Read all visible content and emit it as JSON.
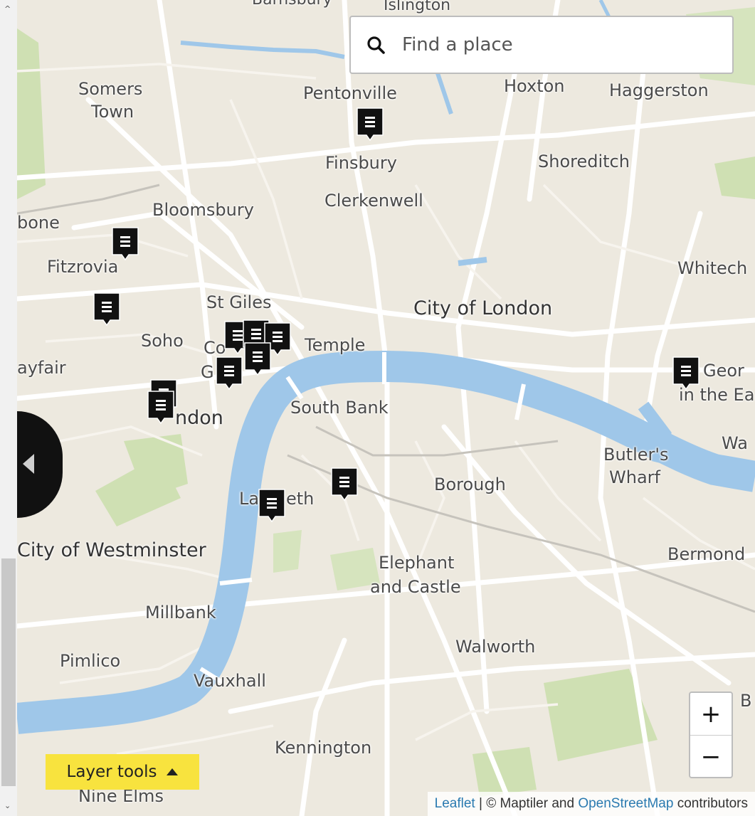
{
  "search": {
    "placeholder": "Find a place",
    "icon": "search-icon"
  },
  "places": {
    "barnsbury": "Barnsbury",
    "islington": "Islington",
    "somers_town_1": "Somers",
    "somers_town_2": "Town",
    "pentonville": "Pentonville",
    "hoxton": "Hoxton",
    "haggerston": "Haggerston",
    "finsbury": "Finsbury",
    "shoreditch": "Shoreditch",
    "clerkenwell": "Clerkenwell",
    "bloomsbury": "Bloomsbury",
    "marylebone_partial": "bone",
    "fitzrovia": "Fitzrovia",
    "whitechapel_partial": "Whitech",
    "st_giles": "St Giles",
    "city_of_london": "City of London",
    "soho": "Soho",
    "covent_partial": "Co",
    "temple": "Temple",
    "mayfair_partial": "ayfair",
    "garden_partial": "G",
    "st_george_partial_1": "Geor",
    "st_george_partial_2": "in the Ea",
    "london_partial": "ndon",
    "south_bank": "South Bank",
    "wapping_partial": "Wa",
    "butlers_wharf_1": "Butler's",
    "butlers_wharf_2": "Wharf",
    "borough": "Borough",
    "lambeth_partial_1": "La",
    "lambeth_partial_2": "eth",
    "city_of_westminster": "City of Westminster",
    "bermondsey_partial": "Bermond",
    "elephant_1": "Elephant",
    "elephant_2": "and Castle",
    "millbank": "Millbank",
    "walworth": "Walworth",
    "pimlico": "Pimlico",
    "vauxhall": "Vauxhall",
    "kennington": "Kennington",
    "nine_elms": "Nine Elms",
    "edge_b": "B"
  },
  "markers": {
    "icon": "document-marker-icon",
    "color": "#111111",
    "count": 13
  },
  "controls": {
    "zoom_in": "+",
    "zoom_out": "−",
    "layer_tools": "Layer tools",
    "sidebar_toggle_icon": "chevron-left-icon"
  },
  "attribution": {
    "leaflet": "Leaflet",
    "separator": " | © Maptiler and ",
    "osm": "OpenStreetMap",
    "contributors": " contributors"
  },
  "colors": {
    "water": "#9fc7e9",
    "park": "#cfe0b3",
    "land": "#ede9df",
    "layer_tools_bg": "#f8e33e"
  }
}
